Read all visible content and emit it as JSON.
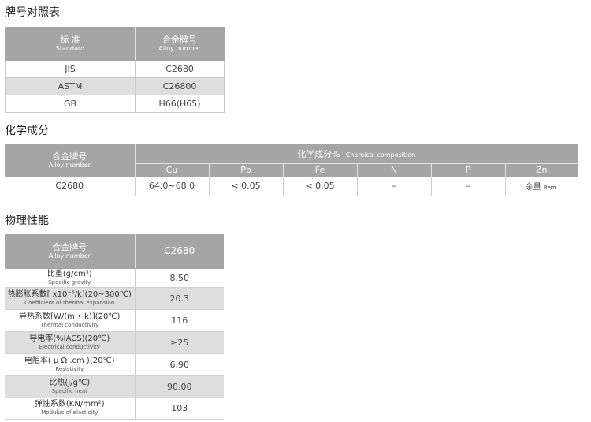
{
  "sections": {
    "grade_table": {
      "title": "牌号对照表"
    },
    "chem_table": {
      "title": "化学成分"
    },
    "phys_table": {
      "title": "物理性能"
    }
  },
  "grade_table": {
    "headers": [
      {
        "zh": "标 准",
        "en": "Standard"
      },
      {
        "zh": "合金牌号",
        "en": "Alloy number"
      }
    ],
    "rows": [
      {
        "standard": "JIS",
        "alloy": "C2680"
      },
      {
        "standard": "ASTM",
        "alloy": "C26800"
      },
      {
        "standard": "GB",
        "alloy": "H66(H65)"
      }
    ]
  },
  "chem_table": {
    "alloy_header": {
      "zh": "合金牌号",
      "en": "Alloy number"
    },
    "caption": {
      "zh": "化学成分%",
      "en": "Chemical composition"
    },
    "elements": [
      "Cu",
      "Pb",
      "Fe",
      "N",
      "P",
      "Zn"
    ],
    "row": {
      "alloy": "C2680",
      "values": [
        "64.0~68.0",
        "< 0.05",
        "< 0.05",
        "–",
        "–"
      ],
      "zn": {
        "zh": "余量",
        "en": "Rem."
      }
    }
  },
  "phys_table": {
    "header": {
      "zh": "合金牌号",
      "en": "Alloy number",
      "value": "C2680"
    },
    "rows": [
      {
        "zh": "比重(g/cm³)",
        "en": "Specific gravity",
        "value": "8.50"
      },
      {
        "zh": "热膨胀系数[ x10⁻⁶/k](20~300℃)",
        "en": "Coefficient of thermal expansion",
        "value": "20.3"
      },
      {
        "zh": "导热系数[W/(m • k)](20℃)",
        "en": "Thermal conductivity",
        "value": "116"
      },
      {
        "zh": "导电率(%IACS)(20℃)",
        "en": "Electrical conductivity",
        "value": "≥25"
      },
      {
        "zh": "电阻率( μ Ω .cm )(20℃)",
        "en": "Resistivity",
        "value": "6.90"
      },
      {
        "zh": "比热(J/g℃)",
        "en": "Specific heat",
        "value": "90.00"
      },
      {
        "zh": "弹性系数(KN/mm²)",
        "en": "Modulus of elasticity",
        "value": "103"
      }
    ]
  }
}
